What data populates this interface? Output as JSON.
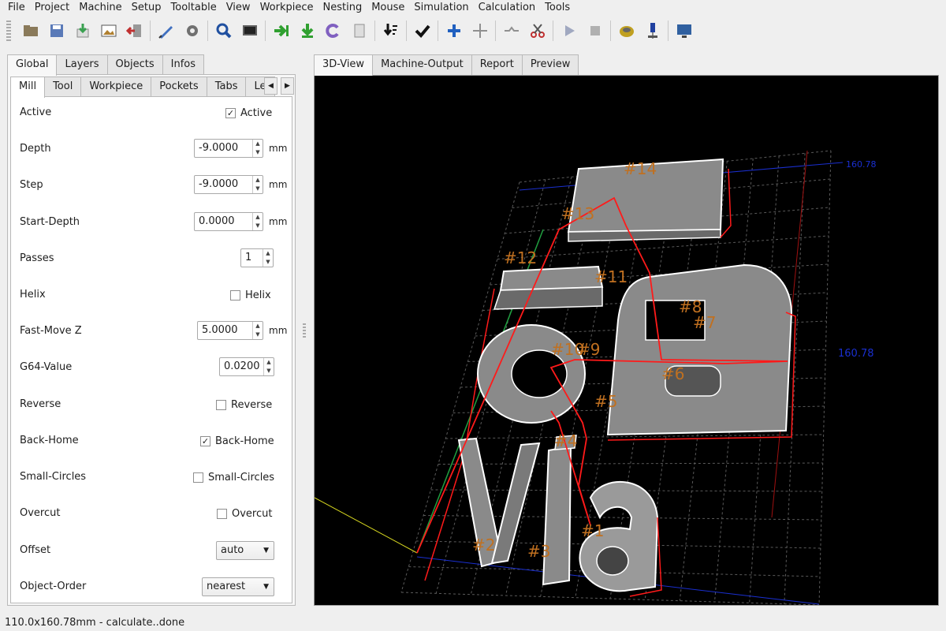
{
  "menu": [
    "File",
    "Project",
    "Machine",
    "Setup",
    "Tooltable",
    "View",
    "Workpiece",
    "Nesting",
    "Mouse",
    "Simulation",
    "Calculation",
    "Tools"
  ],
  "toolbar": {
    "buttons": [
      {
        "icon": "open-folder-icon",
        "color": "#8a7a5a"
      },
      {
        "icon": "save-icon",
        "color": "#5a7ab8"
      },
      {
        "icon": "import-icon",
        "color": "#3aa050"
      },
      {
        "icon": "image-icon",
        "color": "#b08030"
      },
      {
        "icon": "exit-icon",
        "color": "#c03030"
      },
      {
        "icon": "draw-icon",
        "color": "#4070c0"
      },
      {
        "icon": "settings-icon",
        "color": "#707070"
      },
      {
        "icon": "zoom-icon",
        "color": "#2050a0"
      },
      {
        "icon": "monitor-icon",
        "color": "#606060"
      },
      {
        "icon": "arrow-right-icon",
        "color": "#30a030"
      },
      {
        "icon": "arrow-down-icon",
        "color": "#30a030"
      },
      {
        "icon": "rotate-icon",
        "color": "#8060c0"
      },
      {
        "icon": "calculator-icon",
        "color": "#909090"
      },
      {
        "icon": "sort-down-icon",
        "color": "#111111"
      },
      {
        "icon": "checkmark-icon",
        "color": "#111111"
      },
      {
        "icon": "plus-icon",
        "color": "#2060c0"
      },
      {
        "icon": "move-icon",
        "color": "#909090"
      },
      {
        "icon": "path-icon",
        "color": "#909090"
      },
      {
        "icon": "scissors-icon",
        "color": "#c03030"
      },
      {
        "icon": "play-icon",
        "color": "#a0a8c0"
      },
      {
        "icon": "stop-icon",
        "color": "#b0b0b0"
      },
      {
        "icon": "gear-box-icon",
        "color": "#c0a020"
      },
      {
        "icon": "spindle-icon",
        "color": "#2040a0"
      },
      {
        "icon": "screen-icon",
        "color": "#3060a0"
      }
    ]
  },
  "left_tabs": [
    "Global",
    "Layers",
    "Objects",
    "Infos"
  ],
  "sub_tabs": [
    "Mill",
    "Tool",
    "Workpiece",
    "Pockets",
    "Tabs",
    "Lea"
  ],
  "sub_tab_underlines": [
    "M",
    "T",
    "W",
    "P",
    "T",
    ""
  ],
  "mill": {
    "active": {
      "label": "Active",
      "checkbox_label": "Active",
      "checked": true
    },
    "depth": {
      "label": "Depth",
      "value": "-9.0000",
      "unit": "mm"
    },
    "step": {
      "label": "Step",
      "value": "-9.0000",
      "unit": "mm"
    },
    "start_depth": {
      "label": "Start-Depth",
      "value": "0.0000",
      "unit": "mm"
    },
    "passes": {
      "label": "Passes",
      "value": "1"
    },
    "helix": {
      "label": "Helix",
      "checkbox_label": "Helix",
      "checked": false
    },
    "fast_move_z": {
      "label": "Fast-Move Z",
      "value": "5.0000",
      "unit": "mm"
    },
    "g64": {
      "label": "G64-Value",
      "value": "0.0200"
    },
    "reverse": {
      "label": "Reverse",
      "checkbox_label": "Reverse",
      "checked": false
    },
    "back_home": {
      "label": "Back-Home",
      "checkbox_label": "Back-Home",
      "checked": true
    },
    "small_circles": {
      "label": "Small-Circles",
      "checkbox_label": "Small-Circles",
      "checked": false
    },
    "overcut": {
      "label": "Overcut",
      "checkbox_label": "Overcut",
      "checked": false
    },
    "offset": {
      "label": "Offset",
      "value": "auto"
    },
    "object_order": {
      "label": "Object-Order",
      "value": "nearest"
    }
  },
  "right_tabs": [
    "3D-View",
    "Machine-Output",
    "Report",
    "Preview"
  ],
  "view3d": {
    "dim_top": "160.78",
    "dim_side": "160.78",
    "object_labels": [
      "#14",
      "#13",
      "#12",
      "#11",
      "#8",
      "#7",
      "#10",
      "#9",
      "#6",
      "#5",
      "#4",
      "#1",
      "#2",
      "#3"
    ]
  },
  "status": "110.0x160.78mm - calculate..done",
  "colors": {
    "toolpath": "#ff1a1a",
    "label": "#c07020",
    "dimension": "#1a2fd0",
    "grid": "#5a5a5a",
    "wire": "#ffffff",
    "fill": "#8a8a8a",
    "axis_y": "#d8d820",
    "axis_z": "#20a040"
  }
}
